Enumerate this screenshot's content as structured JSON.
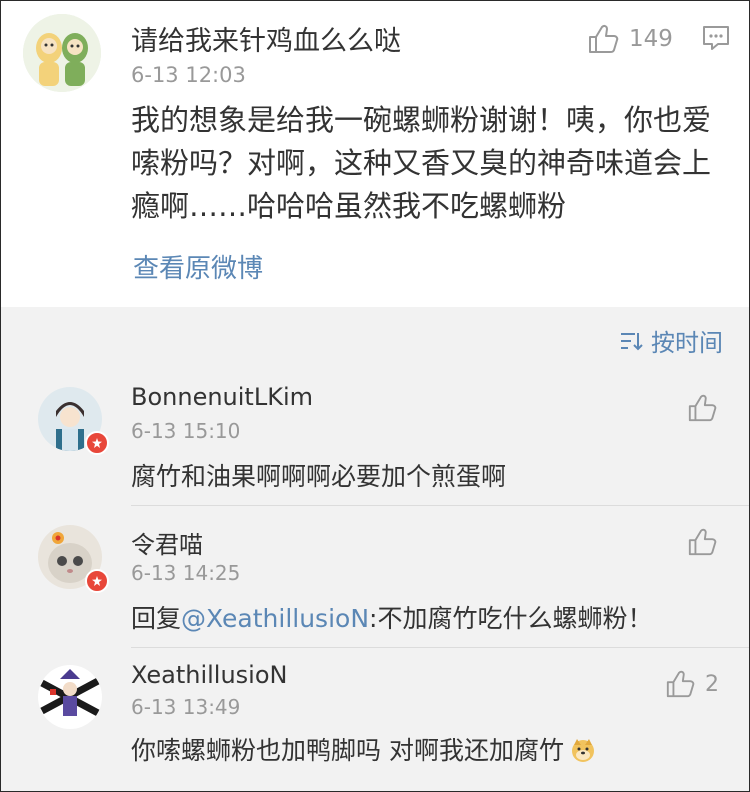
{
  "post": {
    "username": "请给我来针鸡血么么哒",
    "time": "6-13 12:03",
    "like_count": "149",
    "body": "我的想象是给我一碗螺蛳粉谢谢！咦，你也爱嗦粉吗？对啊，这种又香又臭的神奇味道会上瘾啊……哈哈哈虽然我不吃螺蛳粉",
    "view_original_label": "查看原微博"
  },
  "sort": {
    "label": "按时间",
    "icon": "sort-icon"
  },
  "comments": [
    {
      "username": "BonnenuitLKim",
      "time": "6-13 15:10",
      "text": "腐竹和油果啊啊啊必要加个煎蛋啊",
      "like_count": ""
    },
    {
      "username": "令君喵",
      "time": "6-13 14:25",
      "reply_prefix": "回复",
      "mention": "@XeathillusioN",
      "text": ":不加腐竹吃什么螺蛳粉！",
      "like_count": ""
    },
    {
      "username": "XeathillusioN",
      "time": "6-13 13:49",
      "text": "你嗦螺蛳粉也加鸭脚吗 对啊我还加腐竹",
      "like_count": "2",
      "emoji": "doge-emoji"
    }
  ],
  "colors": {
    "link": "#5b87b5",
    "muted": "#999999",
    "text": "#333333",
    "badge": "#e8473a"
  }
}
